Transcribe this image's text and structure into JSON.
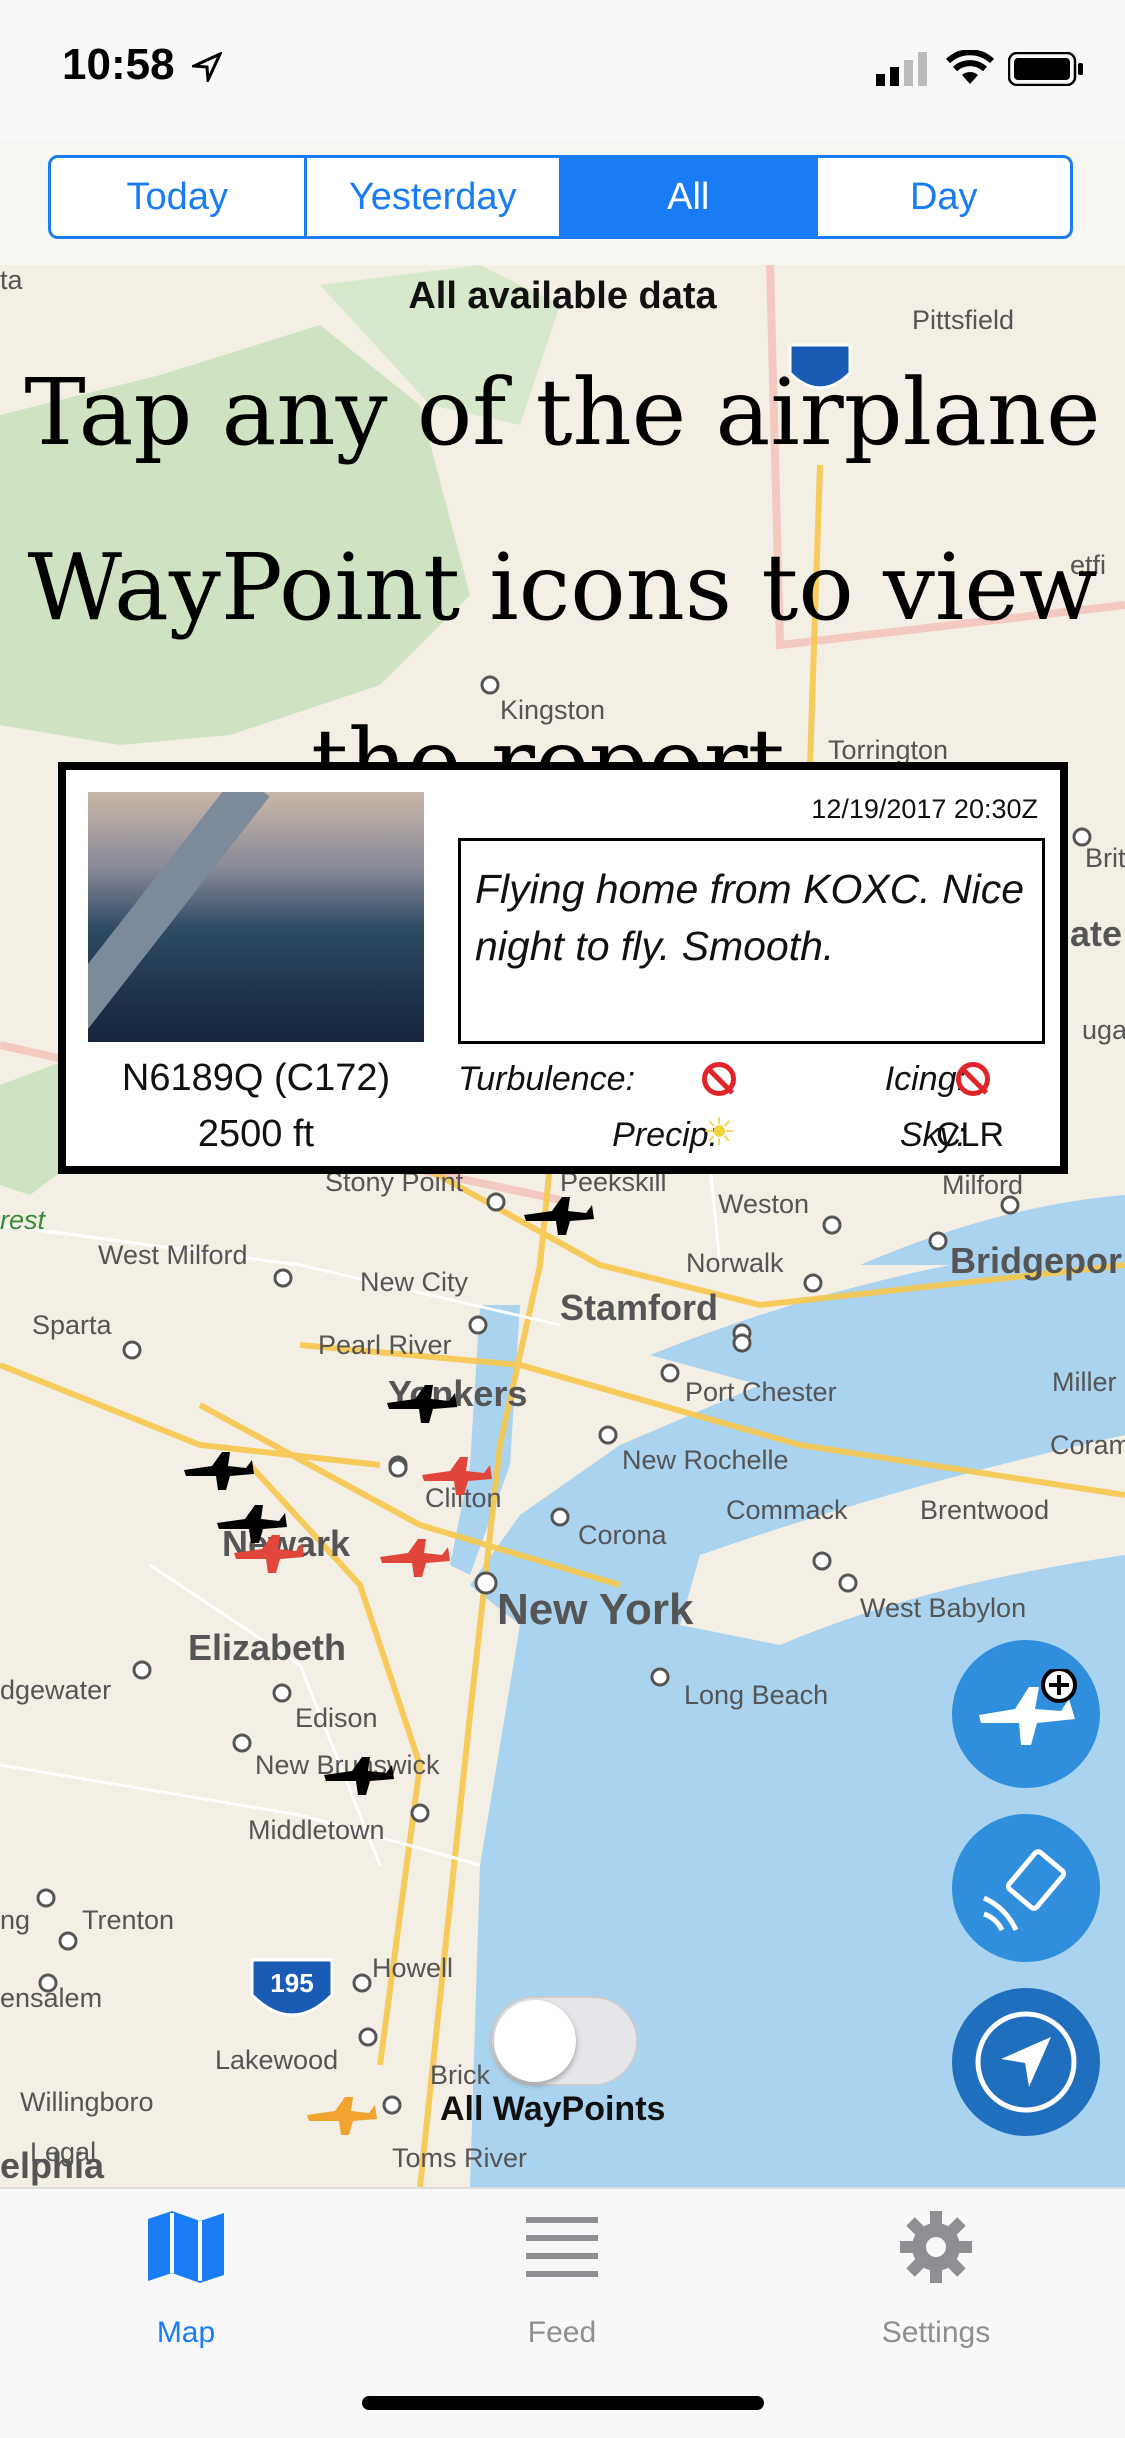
{
  "status_bar": {
    "time": "10:58"
  },
  "segments": [
    {
      "label": "Today",
      "selected": false
    },
    {
      "label": "Yesterday",
      "selected": false
    },
    {
      "label": "All",
      "selected": true
    },
    {
      "label": "Day",
      "selected": false
    }
  ],
  "overlay": {
    "title": "All available data",
    "hint": "Tap any of the airplane WayPoint icons to view the report."
  },
  "map": {
    "labels": {
      "pittsfield": "Pittsfield",
      "kingston": "Kingston",
      "torrington": "Torrington",
      "stony_point": "Stony Point",
      "peekskill": "Peekskill",
      "weston": "Weston",
      "milford": "Milford",
      "west_milford": "West Milford",
      "norwalk": "Norwalk",
      "bridgeport": "Bridgepor",
      "new_city": "New City",
      "stamford": "Stamford",
      "sparta": "Sparta",
      "pearl_river": "Pearl River",
      "yonkers": "Yonkers",
      "port_chester": "Port Chester",
      "clifton": "Clifton",
      "new_rochelle": "New Rochelle",
      "newark": "Newark",
      "commack": "Commack",
      "brentwood": "Brentwood",
      "corona": "Corona",
      "new_york": "New York",
      "west_babylon": "West Babylon",
      "elizabeth": "Elizabeth",
      "bridgewater": "dgewater",
      "long_beach": "Long Beach",
      "edison": "Edison",
      "new_brunswick": "New Brunswick",
      "middletown": "Middletown",
      "trenton": "Trenton",
      "howell": "Howell",
      "hamilton": "ng",
      "bensalem": "ensalem",
      "lakewood": "Lakewood",
      "brick": "Brick",
      "willingboro": "Willingboro",
      "legal": "Legal",
      "philadelphia": "elphia",
      "toms_river": "Toms River",
      "miller": "Miller",
      "coram": "Coram",
      "brita": "Brita",
      "ate": "ate",
      "ugat": "ugat",
      "forest": "rest",
      "wetf": "etfi",
      "ta": "ta",
      "shield_195": "195"
    }
  },
  "report": {
    "date": "12/19/2017 20:30Z",
    "message": "Flying home from KOXC. Nice night to fly. Smooth.",
    "aircraft": "N6189Q (C172)",
    "altitude": "2500 ft",
    "turbulence_label": "Turbulence:",
    "icing_label": "Icing:",
    "precip_label": "Precip:",
    "sky_label": "Sky:",
    "sky_value": "CLR",
    "turbulence_icon": "prohibited-icon",
    "icing_icon": "prohibited-icon",
    "precip_icon": "sun-icon"
  },
  "toggle": {
    "label": "All WayPoints",
    "on": false
  },
  "tabs": [
    {
      "label": "Map",
      "icon": "map-icon",
      "active": true
    },
    {
      "label": "Feed",
      "icon": "list-icon",
      "active": false
    },
    {
      "label": "Settings",
      "icon": "gear-icon",
      "active": false
    }
  ],
  "colors": {
    "accent": "#1a7cf5",
    "fab": "#2f8fdd",
    "water": "#a9d3ee",
    "plane_black": "#000000",
    "plane_red": "#e2453a",
    "plane_orange": "#f2a431"
  }
}
